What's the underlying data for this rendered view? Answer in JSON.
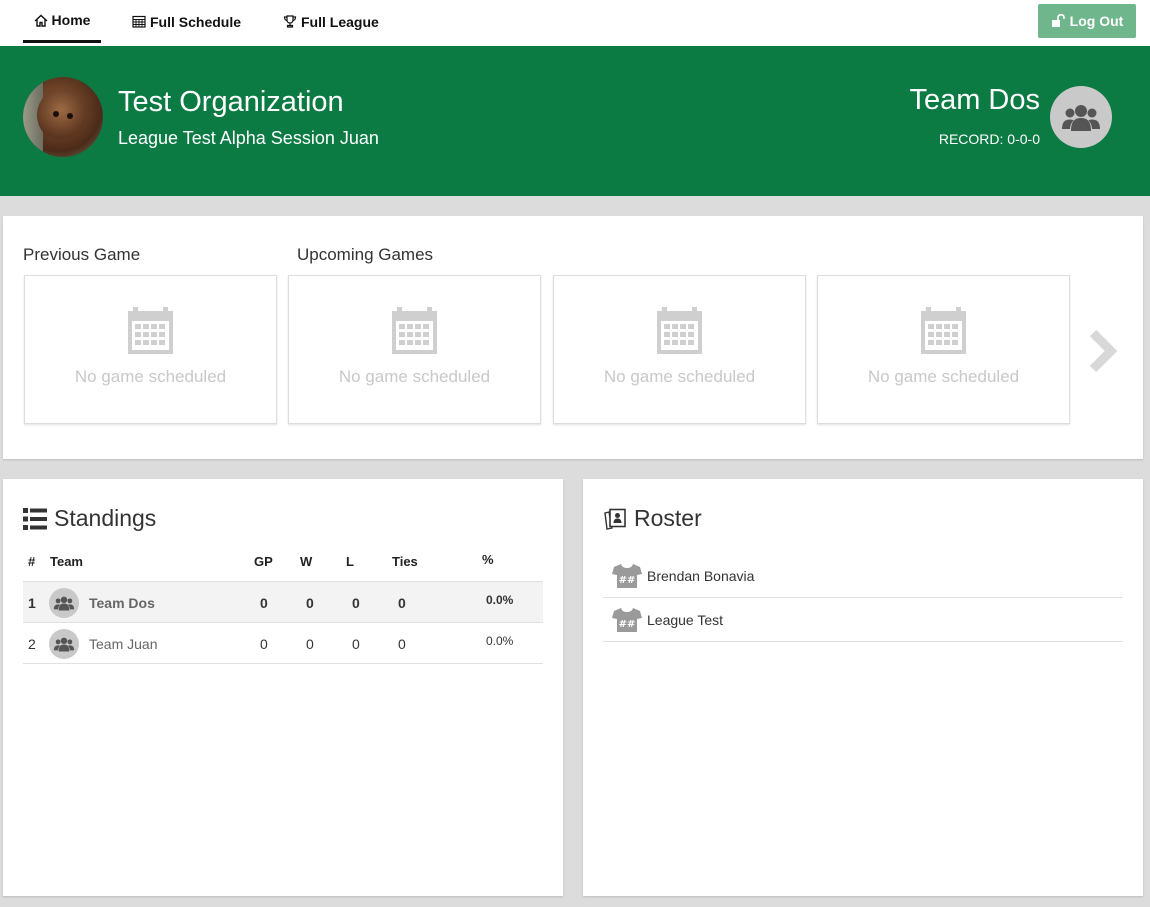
{
  "nav": {
    "tabs": [
      {
        "label": "Home",
        "icon": "home-icon"
      },
      {
        "label": "Full Schedule",
        "icon": "calendar-icon"
      },
      {
        "label": "Full League",
        "icon": "trophy-icon"
      }
    ],
    "logout_label": "Log Out"
  },
  "header": {
    "org_name": "Test Organization",
    "league_name": "League Test Alpha Session Juan",
    "team_name": "Team Dos",
    "record": "RECORD: 0-0-0"
  },
  "games": {
    "previous_label": "Previous Game",
    "upcoming_label": "Upcoming Games",
    "cards": [
      {
        "text": "No game scheduled"
      },
      {
        "text": "No game scheduled"
      },
      {
        "text": "No game scheduled"
      },
      {
        "text": "No game scheduled"
      }
    ]
  },
  "standings": {
    "title": "Standings",
    "columns": {
      "rank": "#",
      "team": "Team",
      "gp": "GP",
      "w": "W",
      "l": "L",
      "ties": "Ties",
      "pct": "%"
    },
    "rows": [
      {
        "rank": "1",
        "team": "Team Dos",
        "gp": "0",
        "w": "0",
        "l": "0",
        "ties": "0",
        "pct": "0.0%"
      },
      {
        "rank": "2",
        "team": "Team Juan",
        "gp": "0",
        "w": "0",
        "l": "0",
        "ties": "0",
        "pct": "0.0%"
      }
    ]
  },
  "roster": {
    "title": "Roster",
    "players": [
      {
        "name": "Brendan Bonavia"
      },
      {
        "name": "League Test"
      }
    ]
  },
  "colors": {
    "header_bg": "#0b7b43",
    "logout_bg": "#6fb68c"
  }
}
